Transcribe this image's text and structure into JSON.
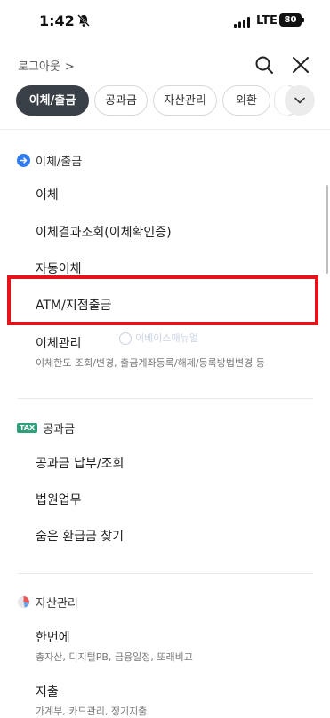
{
  "status": {
    "time": "1:42",
    "network": "LTE",
    "battery": "80"
  },
  "header": {
    "logout_label": "로그아웃",
    "logout_chevron": ">"
  },
  "tabs": [
    {
      "label": "이체/출금",
      "active": true
    },
    {
      "label": "공과금"
    },
    {
      "label": "자산관리"
    },
    {
      "label": "외환"
    }
  ],
  "sections": {
    "transfer": {
      "title": "이체/출금",
      "items": [
        "이체",
        "이체결과조회(이체확인증)",
        "자동이체",
        "ATM/지점출금",
        "이체관리"
      ],
      "manage_desc": "이체한도 조회/변경, 출금계좌등록/해제/등록방법변경 등"
    },
    "utility": {
      "badge": "TAX",
      "title": "공과금",
      "items": [
        "공과금 납부/조회",
        "법원업무",
        "숨은 환급금 찾기"
      ]
    },
    "assets": {
      "title": "자산관리",
      "items": [
        "한번에",
        "지출"
      ],
      "hanbeon_desc": "총자산, 디지털PB, 금융일정, 또래비교",
      "spend_desc": "가계부, 카드관리, 정기지출"
    }
  },
  "watermark": "이베이스매뉴얼",
  "colors": {
    "accent_blue": "#2f7bf2",
    "tab_active": "#3a4047",
    "highlight_red": "#e5131a",
    "tax_green": "#2fa07a"
  }
}
